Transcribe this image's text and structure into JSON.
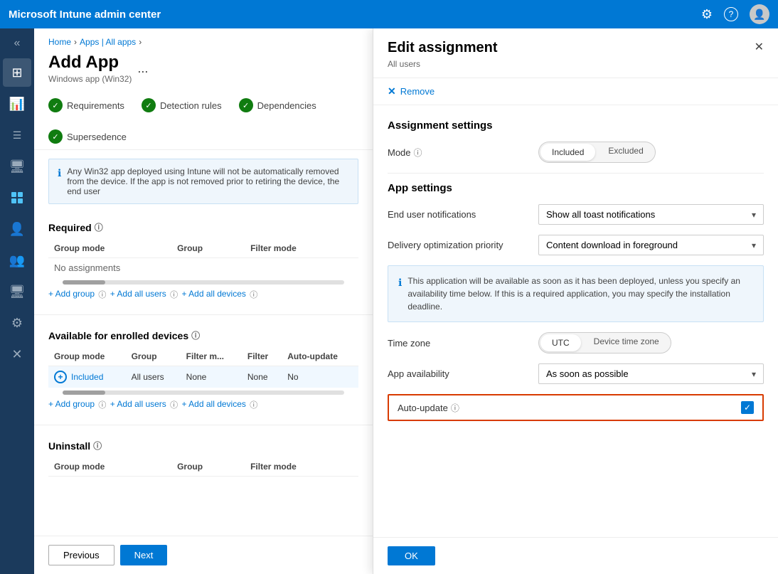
{
  "topbar": {
    "title": "Microsoft Intune admin center",
    "settings_icon": "⚙",
    "help_icon": "?",
    "avatar_label": "👤"
  },
  "sidebar": {
    "chevron": "«",
    "items": [
      {
        "icon": "⊞",
        "label": "Dashboard",
        "active": false
      },
      {
        "icon": "📊",
        "label": "Reports",
        "active": false
      },
      {
        "icon": "☰",
        "label": "All services",
        "active": false
      },
      {
        "icon": "□",
        "label": "Devices",
        "active": false
      },
      {
        "icon": "▦",
        "label": "Apps",
        "active": true
      },
      {
        "icon": "👤",
        "label": "Users",
        "active": false
      },
      {
        "icon": "👥",
        "label": "Groups",
        "active": false
      },
      {
        "icon": "🖥",
        "label": "Tenant admin",
        "active": false
      },
      {
        "icon": "⚙",
        "label": "Settings",
        "active": false
      },
      {
        "icon": "✕",
        "label": "Close",
        "active": false
      }
    ]
  },
  "breadcrumb": {
    "home": "Home",
    "apps": "Apps | All apps",
    "current": ""
  },
  "page": {
    "title": "Add App",
    "more": "...",
    "subtitle": "Windows app (Win32)"
  },
  "steps": [
    {
      "label": "Requirements"
    },
    {
      "label": "Detection rules"
    },
    {
      "label": "Dependencies"
    }
  ],
  "info_banner": {
    "text": "Any Win32 app deployed using Intune will not be automatically removed from the device. If the app is not removed prior to retiring the device, the end user"
  },
  "required_section": {
    "title": "Required",
    "columns": [
      "Group mode",
      "Group",
      "Filter mode"
    ],
    "no_assignments": "No assignments",
    "add_links": [
      "+ Add group",
      "+ Add all users",
      "+ Add all devices"
    ]
  },
  "available_section": {
    "title": "Available for enrolled devices",
    "columns": [
      "Group mode",
      "Group",
      "Filter m...",
      "Filter",
      "Auto-update"
    ],
    "row": {
      "group_mode": "Included",
      "group": "All users",
      "filter_m": "None",
      "filter": "None",
      "auto_update": "No"
    },
    "add_links": [
      "+ Add group",
      "+ Add all users",
      "+ Add all devices"
    ]
  },
  "uninstall_section": {
    "title": "Uninstall",
    "columns": [
      "Group mode",
      "Group",
      "Filter mode"
    ]
  },
  "bottom_buttons": {
    "previous": "Previous",
    "next": "Next"
  },
  "edit_panel": {
    "title": "Edit assignment",
    "subtitle": "All users",
    "close_icon": "✕",
    "remove_label": "Remove",
    "assignment_settings_heading": "Assignment settings",
    "mode_label": "Mode",
    "info_icon": "ⓘ",
    "mode_options": [
      "Included",
      "Excluded"
    ],
    "mode_active": "Included",
    "app_settings_heading": "App settings",
    "end_user_notifications_label": "End user notifications",
    "end_user_notifications_value": "Show all toast notifications",
    "delivery_optimization_label": "Delivery optimization priority",
    "delivery_optimization_value": "Content download in foreground",
    "info_box_text": "This application will be available as soon as it has been deployed, unless you specify an availability time below. If this is a required application, you may specify the installation deadline.",
    "time_zone_label": "Time zone",
    "time_zone_options": [
      "UTC",
      "Device time zone"
    ],
    "time_zone_active": "UTC",
    "app_availability_label": "App availability",
    "app_availability_value": "As soon as possible",
    "auto_update_label": "Auto-update",
    "auto_update_checked": true,
    "ok_label": "OK"
  }
}
